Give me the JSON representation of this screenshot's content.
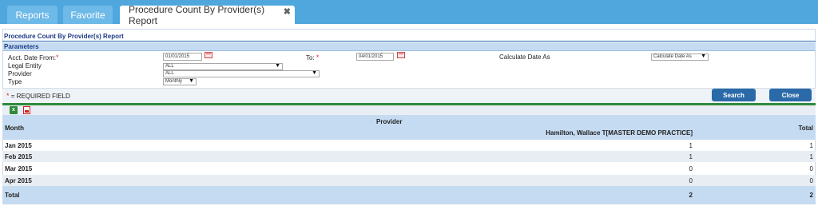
{
  "tabs": [
    {
      "label": "Reports"
    },
    {
      "label": "Favorite"
    },
    {
      "label": "Procedure Count By Provider(s) Report"
    }
  ],
  "report": {
    "title": "Procedure Count By Provider(s) Report"
  },
  "parameters": {
    "heading": "Parameters",
    "acct_from_label": "Acct. Date From:",
    "acct_from_value": "01/01/2015",
    "to_label": "To:",
    "to_value": "04/01/2015",
    "calc_label": "Calculate Date As",
    "calc_value": "Calculate Date As",
    "legal_label": "Legal Entity",
    "legal_value": "ALL",
    "provider_label": "Provider",
    "provider_value": "ALL",
    "type_label": "Type",
    "type_value": "Monthly",
    "required_star": "*"
  },
  "actions": {
    "required_note": "= REQUIRED FIELD",
    "search_label": "Search",
    "close_label": "Close"
  },
  "table": {
    "month_header": "Month",
    "provider_header": "Provider",
    "provider_name": "Hamilton, Wallace T[MASTER DEMO PRACTICE]",
    "total_header": "Total",
    "rows": [
      {
        "month": "Jan 2015",
        "count": "1",
        "total": "1"
      },
      {
        "month": "Feb 2015",
        "count": "1",
        "total": "1"
      },
      {
        "month": "Mar 2015",
        "count": "0",
        "total": "0"
      },
      {
        "month": "Apr 2015",
        "count": "0",
        "total": "0"
      }
    ],
    "total_row": {
      "label": "Total",
      "count": "2",
      "total": "2"
    }
  },
  "icons": {
    "excel": "excel-export-icon",
    "pdf": "pdf-export-icon",
    "calendar": "calendar-icon",
    "dropdown": "dropdown-arrow-icon"
  }
}
